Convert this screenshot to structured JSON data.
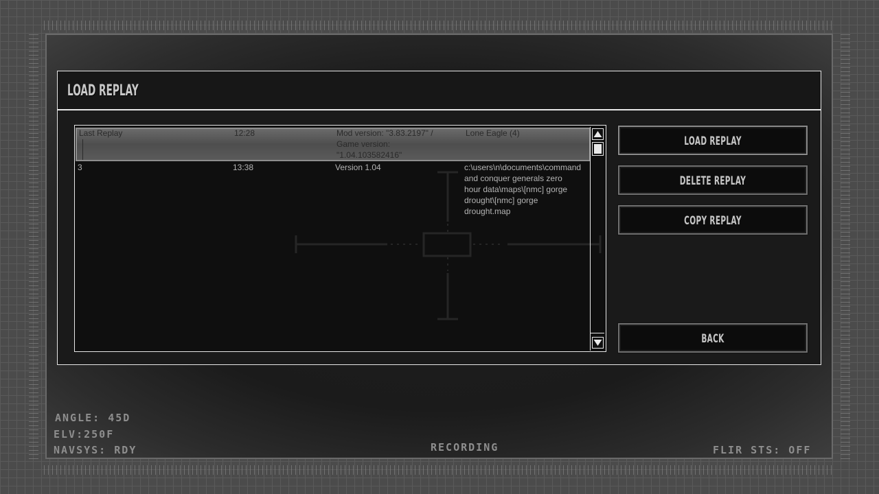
{
  "dialog": {
    "title": "LOAD REPLAY"
  },
  "replays": {
    "selected": {
      "name": "Last Replay",
      "time": "12:28",
      "version": "Mod version: \"3.83.2197\" /\n Game version:\n \"1.04.103582416\"",
      "map": "Lone Eagle (4)"
    },
    "rows": [
      {
        "name": "3",
        "time": "13:38",
        "version": "Version 1.04",
        "map": "c:\\users\\n\\documents\\command\n and conquer generals zero\n hour data\\maps\\[nmc] gorge\n drought\\[nmc] gorge\n drought.map"
      }
    ]
  },
  "buttons": {
    "load": "LOAD REPLAY",
    "delete": "DELETE REPLAY",
    "copy": "COPY REPLAY",
    "back": "BACK"
  },
  "hud": {
    "angle": "ANGLE: 45D",
    "elevation": "ELV:250F",
    "navsys": "NAVSYS: RDY",
    "status": "RECORDING",
    "flir": "FLIR STS: OFF"
  },
  "icons": {
    "scroll_up": "triangle-up-icon",
    "scroll_down": "triangle-down-icon"
  }
}
